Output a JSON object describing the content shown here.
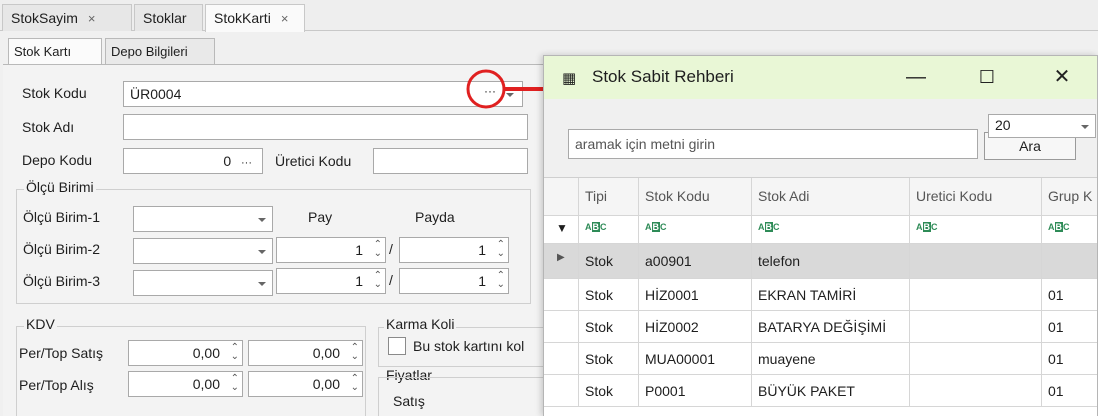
{
  "doc_tabs": [
    {
      "label": "StokSayim",
      "close": "×"
    },
    {
      "label": "Stoklar"
    },
    {
      "label": "StokKarti",
      "close": "×"
    }
  ],
  "inner_tabs": [
    "Stok Kartı",
    "Depo Bilgileri"
  ],
  "form": {
    "stok_kodu_label": "Stok Kodu",
    "stok_kodu_value": "ÜR0004",
    "ellipsis": "···",
    "stok_adi_label": "Stok Adı",
    "depo_kodu_label": "Depo Kodu",
    "depo_kodu_value": "0",
    "uretici_kodu_label": "Üretici Kodu",
    "olcu_birimi_title": "Ölçü Birimi",
    "olcu_1": "Ölçü Birim-1",
    "olcu_2": "Ölçü Birim-2",
    "olcu_3": "Ölçü Birim-3",
    "pay_label": "Pay",
    "payda_label": "Payda",
    "pay_2": "1",
    "payda_2": "1",
    "pay_3": "1",
    "payda_3": "1",
    "slash": "/",
    "kdv_title": "KDV",
    "per_top_satis": "Per/Top Satış",
    "per_top_alis": "Per/Top Alış",
    "satis_1": "0,00",
    "satis_2": "0,00",
    "alis_1": "0,00",
    "alis_2": "0,00",
    "karma_koli_title": "Karma Koli",
    "karma_koli_check": "Bu stok kartını kol",
    "fiyatlar_title": "Fiyatlar",
    "satis_title": "Satış"
  },
  "dialog": {
    "title": "Stok Sabit Rehberi",
    "minimize": "—",
    "maximize": "☐",
    "close": "✕",
    "search_placeholder": "aramak için metni girin",
    "page_size": "20",
    "search_button": "Ara",
    "columns": [
      "Tipi",
      "Stok Kodu",
      "Stok Adi",
      "Uretici Kodu",
      "Grup K"
    ],
    "rows": [
      {
        "tipi": "Stok",
        "kodu": "a00901",
        "adi": "telefon",
        "uretici": "",
        "grup": ""
      },
      {
        "tipi": "Stok",
        "kodu": "HİZ0001",
        "adi": "EKRAN TAMİRİ",
        "uretici": "",
        "grup": "01"
      },
      {
        "tipi": "Stok",
        "kodu": "HİZ0002",
        "adi": "BATARYA DEĞİŞİMİ",
        "uretici": "",
        "grup": "01"
      },
      {
        "tipi": "Stok",
        "kodu": "MUA00001",
        "adi": "muayene",
        "uretici": "",
        "grup": "01"
      },
      {
        "tipi": "Stok",
        "kodu": "P0001",
        "adi": "BÜYÜK PAKET",
        "uretici": "",
        "grup": "01"
      }
    ]
  },
  "colors": {
    "annotation": "#e02020",
    "title_bar": "#e9f7d6",
    "selected_row": "#d9d9d9"
  }
}
